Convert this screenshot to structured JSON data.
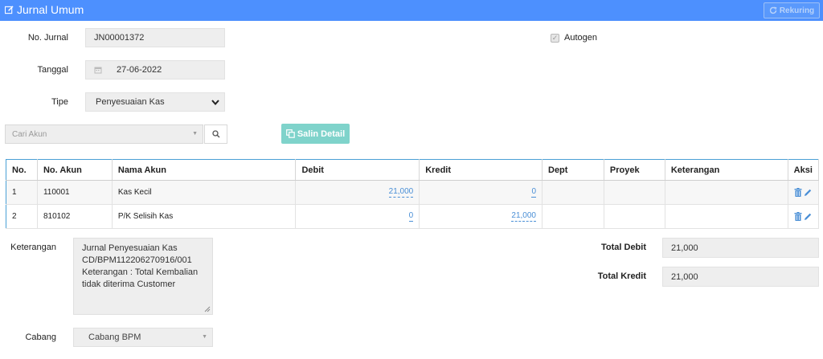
{
  "header": {
    "title": "Jurnal Umum",
    "rekuring_label": "Rekuring"
  },
  "form": {
    "no_jurnal_label": "No. Jurnal",
    "no_jurnal_value": "JN00001372",
    "tanggal_label": "Tanggal",
    "tanggal_value": "27-06-2022",
    "tipe_label": "Tipe",
    "tipe_value": "Penyesuaian Kas",
    "autogen_label": "Autogen",
    "autogen_checked": true
  },
  "toolbar": {
    "search_placeholder": "Cari Akun",
    "salin_label": "Salin Detail"
  },
  "table": {
    "headers": [
      "No.",
      "No. Akun",
      "Nama Akun",
      "Debit",
      "Kredit",
      "Dept",
      "Proyek",
      "Keterangan",
      "Aksi"
    ],
    "rows": [
      {
        "no": "1",
        "no_akun": "110001",
        "nama_akun": "Kas Kecil",
        "debit": "21,000",
        "kredit": "0",
        "dept": "",
        "proyek": "",
        "keterangan": ""
      },
      {
        "no": "2",
        "no_akun": "810102",
        "nama_akun": "P/K Selisih Kas",
        "debit": "0",
        "kredit": "21,000",
        "dept": "",
        "proyek": "",
        "keterangan": ""
      }
    ]
  },
  "footer": {
    "keterangan_label": "Keterangan",
    "keterangan_lines": [
      "Jurnal Penyesuaian Kas",
      "CD/BPM112206270916/001",
      "Keterangan : Total Kembalian",
      "tidak diterima Customer"
    ],
    "cabang_label": "Cabang",
    "cabang_value": "Cabang BPM",
    "total_debit_label": "Total Debit",
    "total_debit_value": "21,000",
    "total_kredit_label": "Total Kredit",
    "total_kredit_value": "21,000"
  },
  "icons": {
    "title": "edit-icon",
    "rekuring": "refresh-icon",
    "tanggal": "calendar-icon",
    "search": "search-icon",
    "salin": "copy-icon",
    "delete": "trash-icon",
    "edit": "pencil-icon"
  },
  "colors": {
    "header_bg": "#4d90fe",
    "salin_btn": "#7fd3cb",
    "table_border": "#4aa0d6",
    "link": "#4a8fd6"
  }
}
